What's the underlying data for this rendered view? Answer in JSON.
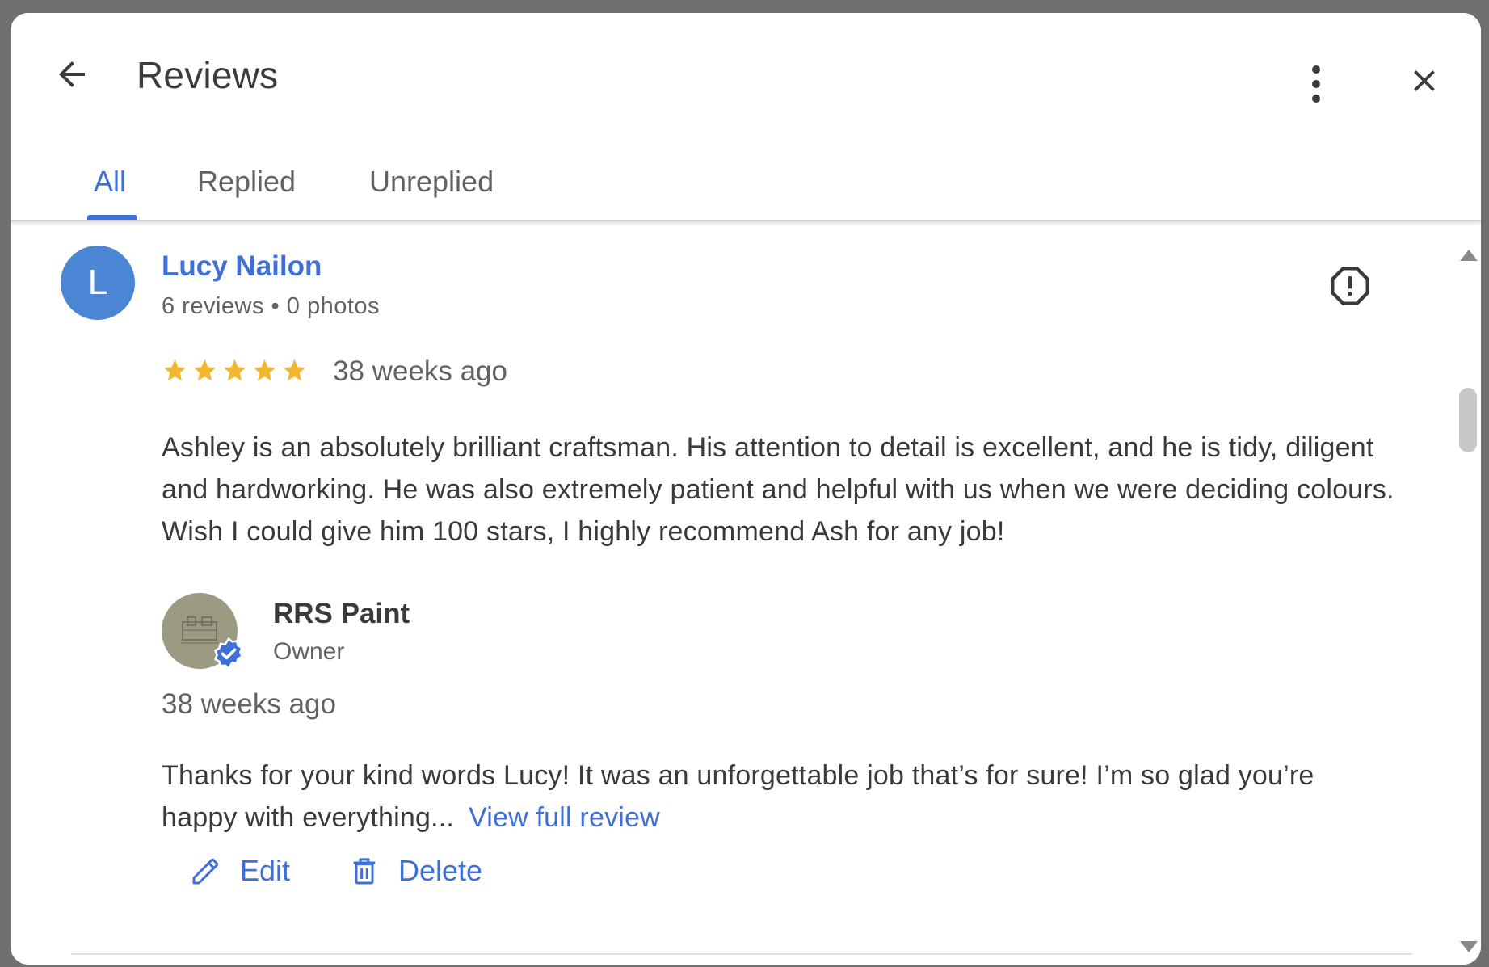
{
  "dialog": {
    "title": "Reviews"
  },
  "icons": {
    "back": "arrow-back-icon",
    "more": "more-vert-icon",
    "close": "close-icon",
    "report": "report-icon",
    "star": "star-icon",
    "verified": "verified-badge-icon",
    "edit": "pencil-icon",
    "delete": "trash-icon"
  },
  "tabs": [
    {
      "label": "All",
      "active": true
    },
    {
      "label": "Replied",
      "active": false
    },
    {
      "label": "Unreplied",
      "active": false
    }
  ],
  "review": {
    "avatar_letter": "L",
    "reviewer_name": "Lucy Nailon",
    "reviewer_meta": "6 reviews • 0 photos",
    "rating": 5,
    "rating_max": 5,
    "time": "38 weeks ago",
    "text": "Ashley is an absolutely brilliant craftsman. His attention to detail is excellent, and he is tidy, diligent and hardworking. He was also extremely patient and helpful with us when we were deciding colours. Wish I could give him 100 stars, I highly recommend Ash for any job!"
  },
  "reply": {
    "owner_name": "RRS Paint",
    "owner_role": "Owner",
    "time": "38 weeks ago",
    "text": "Thanks for your kind words Lucy! It was an unforgettable job that’s for sure! I’m so glad you’re happy with everything...",
    "view_full_label": "View full review"
  },
  "actions": {
    "edit_label": "Edit",
    "delete_label": "Delete"
  },
  "colors": {
    "accent": "#3f6fd8",
    "star": "#f2b731",
    "avatar_bg": "#4a86d3"
  }
}
